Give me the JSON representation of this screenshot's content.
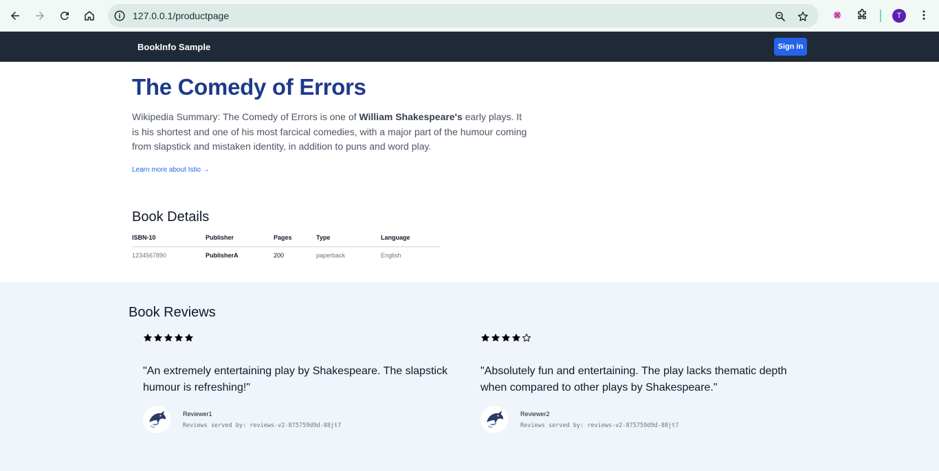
{
  "browser": {
    "url": "127.0.0.1/productpage",
    "profile_initial": "T"
  },
  "header": {
    "brand": "BookInfo Sample",
    "signin_label": "Sign in"
  },
  "product": {
    "title": "The Comedy of Errors",
    "summary_prefix": "Wikipedia Summary: The Comedy of Errors is one of ",
    "summary_author": "William Shakespeare's",
    "summary_suffix": " early plays. It is his shortest and one of his most farcical comedies, with a major part of the humour coming from slapstick and mistaken identity, in addition to puns and word play.",
    "learn_more": "Learn more about Istio →"
  },
  "details": {
    "title": "Book Details",
    "headers": [
      "ISBN-10",
      "Publisher",
      "Pages",
      "Type",
      "Language"
    ],
    "values": [
      "1234567890",
      "PublisherA",
      "200",
      "paperback",
      "English"
    ]
  },
  "reviews": {
    "title": "Book Reviews",
    "items": [
      {
        "rating": 5,
        "max_rating": 5,
        "star_color": "#000000",
        "text": "\"An extremely entertaining play by Shakespeare. The slapstick humour is refreshing!\"",
        "reviewer": "Reviewer1",
        "served_by": "Reviews served by: reviews-v2-875759d9d-88jt7"
      },
      {
        "rating": 4,
        "max_rating": 5,
        "star_color": "#000000",
        "text": "\"Absolutely fun and entertaining. The play lacks thematic depth when compared to other plays by Shakespeare.\"",
        "reviewer": "Reviewer2",
        "served_by": "Reviews served by: reviews-v2-875759d9d-88jt7"
      }
    ]
  },
  "icons": {
    "back": "arrow-left-icon",
    "forward": "arrow-right-icon",
    "reload": "reload-icon",
    "home": "home-icon",
    "site_info": "info-icon",
    "zoom": "zoom-icon",
    "bookmark": "star-outline-icon",
    "extension": "puzzle-icon",
    "menu": "kebab-menu-icon",
    "avatar": "dolphin-icon"
  },
  "colors": {
    "header_bg": "#1f2937",
    "title": "#1e3a8a",
    "link": "#2563eb",
    "signin": "#2563eb",
    "reviews_bg": "#f0f4fb"
  }
}
